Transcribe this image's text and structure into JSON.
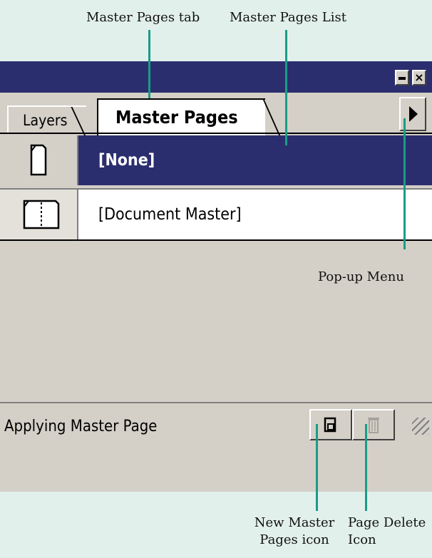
{
  "annotations": {
    "master_pages_tab": "Master Pages tab",
    "master_pages_list": "Master Pages List",
    "popup_menu": "Pop-up Menu",
    "new_master_pages_icon_line1": "New Master",
    "new_master_pages_icon_line2": "Pages icon",
    "page_delete_icon_line1": "Page Delete",
    "page_delete_icon_line2": "Icon"
  },
  "panel": {
    "tabs": [
      {
        "label": "Layers",
        "active": false
      },
      {
        "label": "Master Pages",
        "active": true
      }
    ],
    "list": [
      {
        "label": "[None]",
        "selected": true,
        "icon": "single-page-icon"
      },
      {
        "label": "[Document Master]",
        "selected": false,
        "icon": "spread-page-icon"
      }
    ],
    "status_text": "Applying Master Page",
    "icons": [
      "minimize-icon",
      "close-icon",
      "popup-menu-arrow-icon",
      "new-master-page-icon",
      "trash-icon",
      "resize-grip-icon"
    ]
  },
  "colors": {
    "background": "#e2f0ec",
    "titlebar": "#2b2e6e",
    "panel": "#d4d0c8",
    "leader": "#1a9c86"
  }
}
